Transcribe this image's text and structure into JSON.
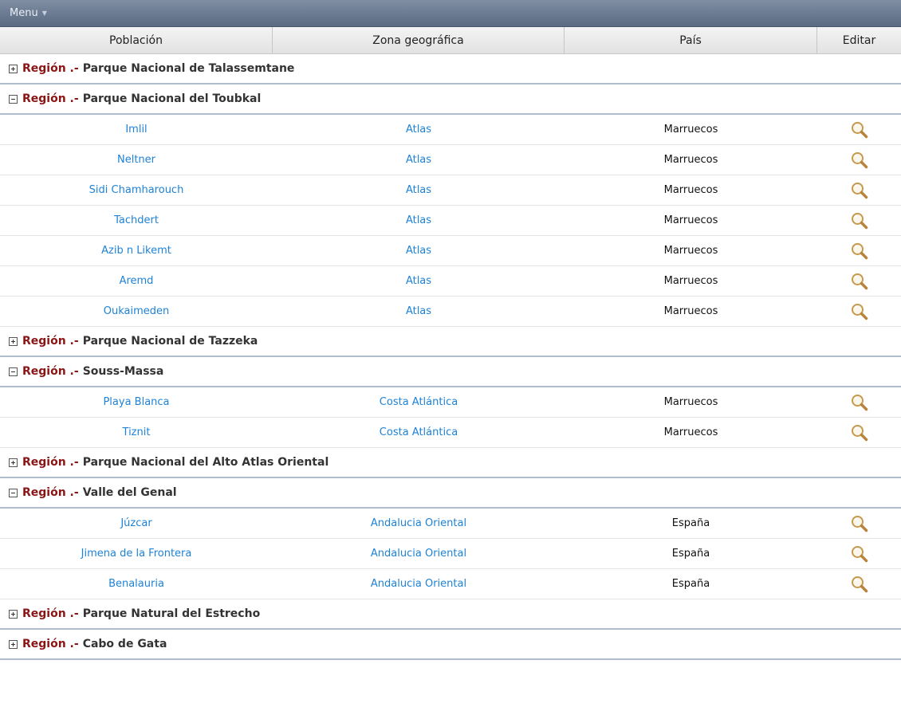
{
  "menu": {
    "label": "Menu",
    "caret_icon": "caret-down-icon"
  },
  "table": {
    "columns": [
      "Población",
      "Zona geográfica",
      "País",
      "Editar"
    ],
    "region_prefix": "Región .-",
    "edit_icon": "magnifier-icon",
    "groups": [
      {
        "name": "Parque Nacional de Talassemtane",
        "expanded": false,
        "rows": []
      },
      {
        "name": "Parque Nacional del Toubkal",
        "expanded": true,
        "rows": [
          {
            "poblacion": "Imlil",
            "zona": "Atlas",
            "pais": "Marruecos"
          },
          {
            "poblacion": "Neltner",
            "zona": "Atlas",
            "pais": "Marruecos"
          },
          {
            "poblacion": "Sidi Chamharouch",
            "zona": "Atlas",
            "pais": "Marruecos"
          },
          {
            "poblacion": "Tachdert",
            "zona": "Atlas",
            "pais": "Marruecos"
          },
          {
            "poblacion": "Azib n Likemt",
            "zona": "Atlas",
            "pais": "Marruecos"
          },
          {
            "poblacion": "Aremd",
            "zona": "Atlas",
            "pais": "Marruecos"
          },
          {
            "poblacion": "Oukaimeden",
            "zona": "Atlas",
            "pais": "Marruecos"
          }
        ]
      },
      {
        "name": "Parque Nacional de Tazzeka",
        "expanded": false,
        "rows": []
      },
      {
        "name": "Souss-Massa",
        "expanded": true,
        "rows": [
          {
            "poblacion": "Playa Blanca",
            "zona": "Costa Atlántica",
            "pais": "Marruecos"
          },
          {
            "poblacion": "Tiznit",
            "zona": "Costa Atlántica",
            "pais": "Marruecos"
          }
        ]
      },
      {
        "name": "Parque Nacional del Alto Atlas Oriental",
        "expanded": false,
        "rows": []
      },
      {
        "name": "Valle del Genal",
        "expanded": true,
        "rows": [
          {
            "poblacion": "Júzcar",
            "zona": "Andalucia Oriental",
            "pais": "España"
          },
          {
            "poblacion": "Jimena de la Frontera",
            "zona": "Andalucia Oriental",
            "pais": "España"
          },
          {
            "poblacion": "Benalauria",
            "zona": "Andalucia Oriental",
            "pais": "España"
          }
        ]
      },
      {
        "name": "Parque Natural del Estrecho",
        "expanded": false,
        "rows": []
      },
      {
        "name": "Cabo de Gata",
        "expanded": false,
        "rows": []
      }
    ]
  }
}
